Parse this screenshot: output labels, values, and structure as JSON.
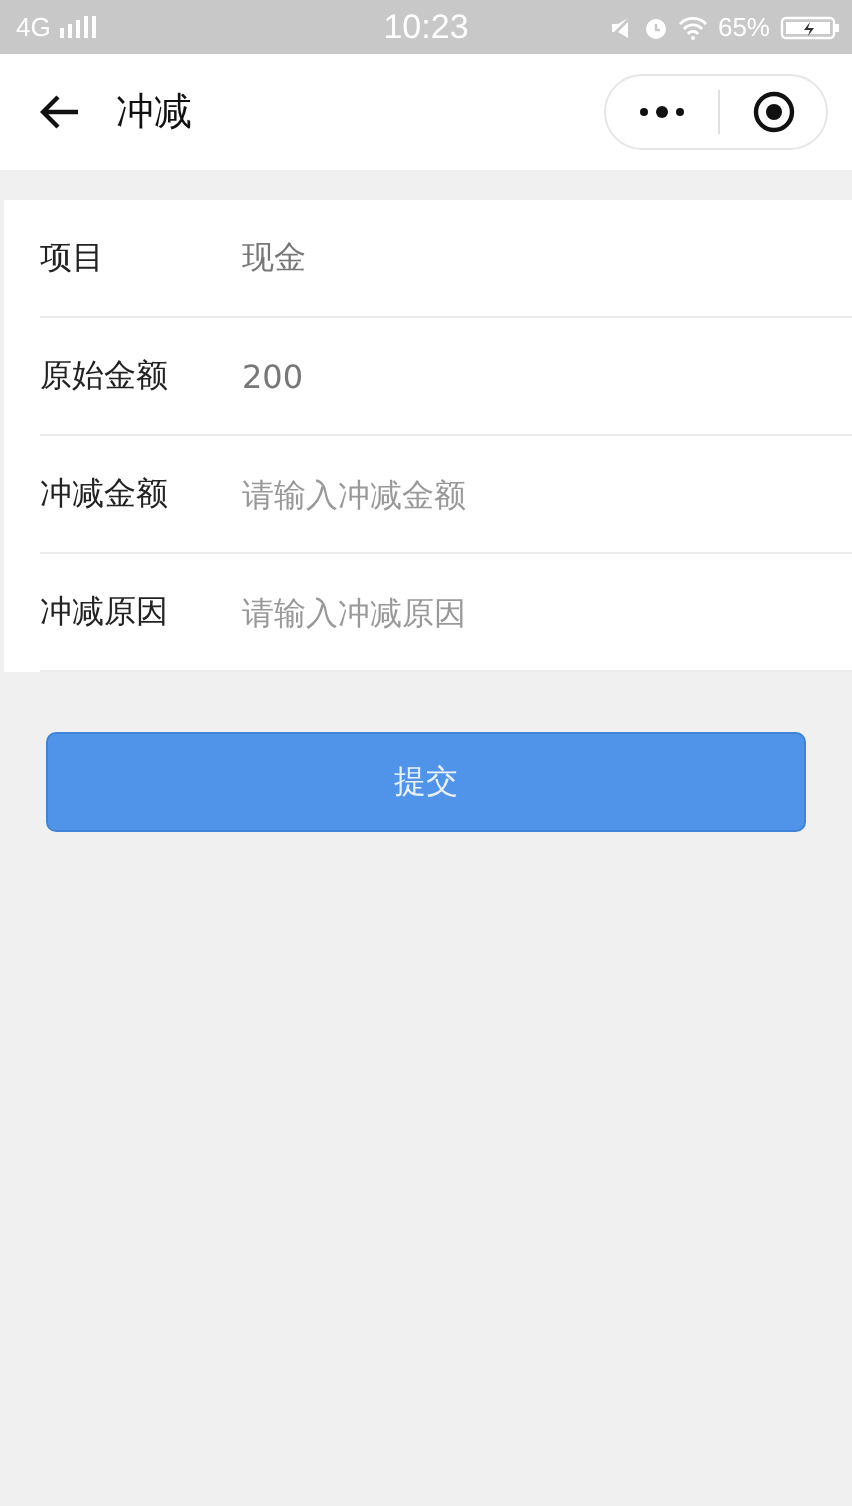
{
  "status_bar": {
    "network": "4G",
    "time": "10:23",
    "battery": "65%"
  },
  "header": {
    "title": "冲减"
  },
  "form": [
    {
      "kind": "text",
      "label": "项目",
      "value": "现金"
    },
    {
      "kind": "text",
      "label": "原始金额",
      "value": "200"
    },
    {
      "kind": "input",
      "label": "冲减金额",
      "placeholder": "请输入冲减金额"
    },
    {
      "kind": "input",
      "label": "冲减原因",
      "placeholder": "请输入冲减原因"
    }
  ],
  "submit": {
    "label": "提交"
  }
}
